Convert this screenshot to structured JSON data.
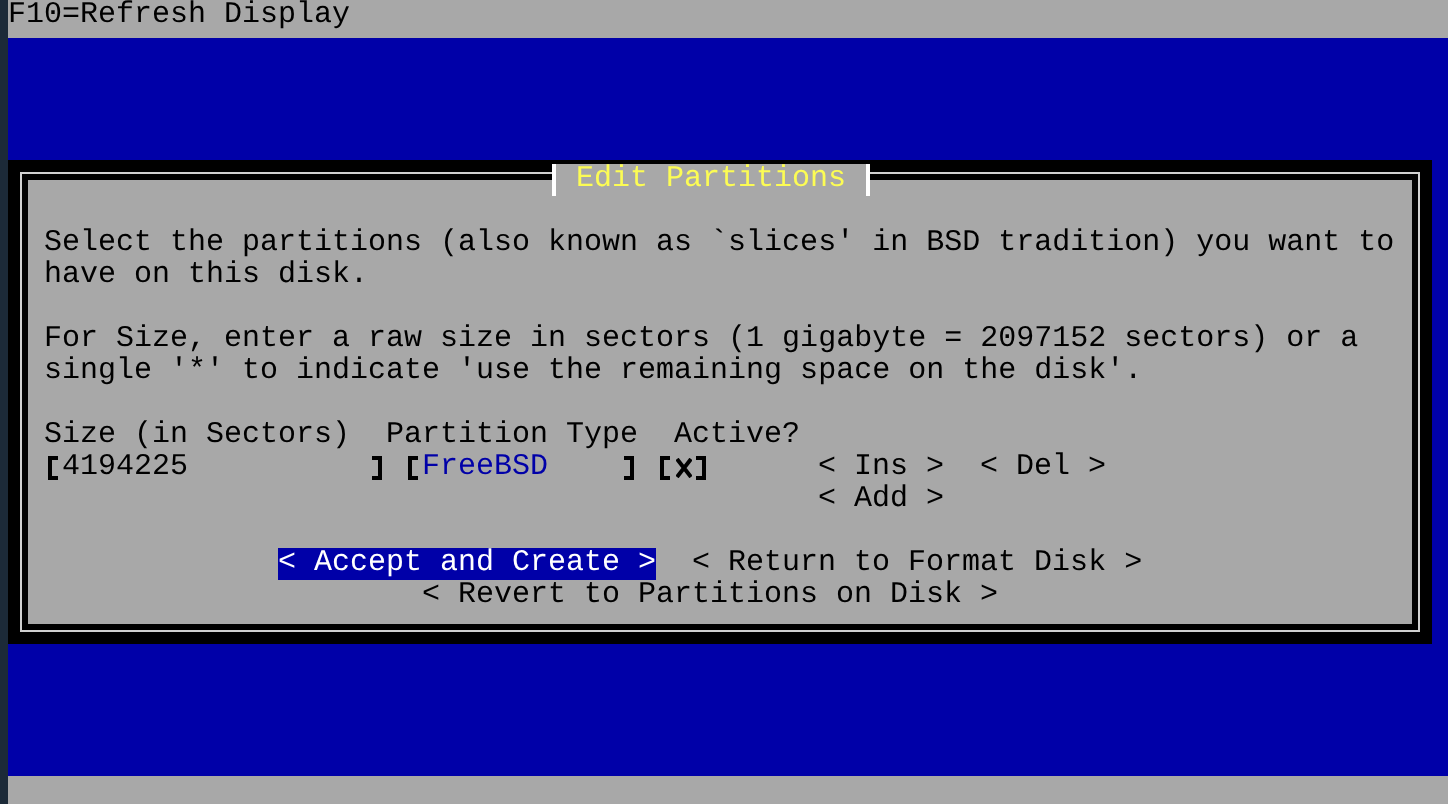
{
  "top_bar": {
    "text": "F10=Refresh Display"
  },
  "dialog": {
    "title": "Edit Partitions",
    "paragraphs": [
      "Select the partitions (also known as `slices' in BSD tradition) you want to have on this disk.",
      "For Size, enter a raw size in sectors (1 gigabyte = 2097152 sectors) or a single '*' to indicate 'use the remaining space on the disk'."
    ],
    "columns": [
      "Size (in Sectors)",
      "Partition Type",
      "Active?"
    ],
    "partitions": [
      {
        "size": "4194225",
        "type": "FreeBSD",
        "active": true
      }
    ],
    "row_buttons": [
      {
        "label": "< Ins >"
      },
      {
        "label": "< Del >"
      },
      {
        "label": "< Add >"
      }
    ],
    "buttons": [
      {
        "label": "< Accept and Create >",
        "selected": true
      },
      {
        "label": "< Return to Format Disk >",
        "selected": false
      },
      {
        "label": "< Revert to Partitions on Disk >",
        "selected": false
      }
    ]
  }
}
